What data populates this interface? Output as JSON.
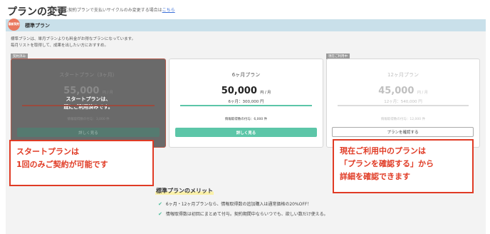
{
  "header": {
    "title": "プランの変更",
    "note": "※ 同じ契約プランで支払いサイクルのみ変更する場合は",
    "note_link": "こちら"
  },
  "plan_section": {
    "badge": "最新契約",
    "label": "標準プラン",
    "description_lines": [
      "標準プランは、単月プランよりも料金がお得なプランになっています。",
      "毎月リストを取得して、成果を出したい方におすすめ。"
    ]
  },
  "cards": [
    {
      "tag": "契約済み",
      "name": "スタートプラン（3ヶ月）",
      "price": "55,000",
      "unit": "円 / 月",
      "sub_price": "",
      "bonus": "情報取得数の付与：3,000 件",
      "button": "詳しく見る",
      "overlay": [
        "スタートプランは、",
        "既にご利用済みです。"
      ]
    },
    {
      "tag": "",
      "name": "6ヶ月プラン",
      "price": "50,000",
      "unit": "円 / 月",
      "sub_price": "6ヶ月：300,000 円",
      "bonus": "情報取得数の付与：6,000 件",
      "button": "詳しく見る"
    },
    {
      "tag": "現在ご利用中",
      "name": "12ヶ月プラン",
      "price": "45,000",
      "unit": "円 / 月",
      "sub_price": "12ヶ月：540,000 円",
      "bonus": "情報取得数の付与：12,000 件",
      "button": "プランを確認する"
    }
  ],
  "callouts": {
    "left": [
      "スタートプランは",
      "1回のみご契約が可能です"
    ],
    "right": [
      "現在ご利用中のプランは",
      "「プランを確認する」から",
      "詳細を確認できます"
    ]
  },
  "merits": {
    "title": "標準プランのメリット",
    "items": [
      "6ヶ月・12ヶ月プランなら、情報取得数の追加購入は通常価格の20%OFF！",
      "情報取得数は初回にまとめて付与。契約期間中ならいつでも、欲しい数だけ使える。"
    ]
  },
  "colors": {
    "accent_green": "#5cc6a8",
    "callout_red": "#e03b25",
    "plan_bar": "#c9e0ea",
    "badge": "#e9785e"
  }
}
